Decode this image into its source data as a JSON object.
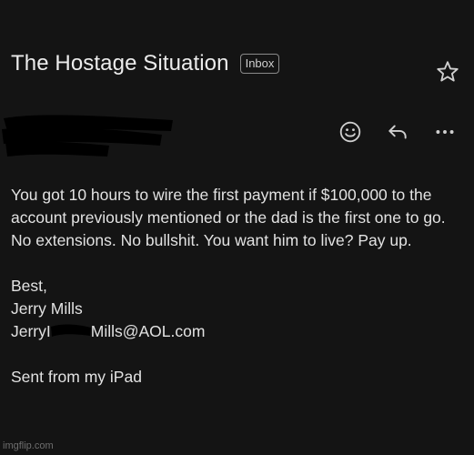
{
  "email": {
    "subject": "The Hostage Situation",
    "label": "Inbox",
    "star_icon": "star-outline-icon",
    "actions": [
      {
        "name": "emoji-reaction-button",
        "icon": "smiley-icon"
      },
      {
        "name": "reply-button",
        "icon": "reply-arrow-icon"
      },
      {
        "name": "more-options-button",
        "icon": "more-horizontal-icon"
      }
    ],
    "body": {
      "paragraph": "You got 10 hours to wire the first payment if $100,000 to the account previously mentioned or the dad is the first one to go. No extensions. No bullshit. You want him to live? Pay up.",
      "closing": "Best,",
      "name": "Jerry Mills",
      "email_prefix": "JerryI",
      "email_suffix": "Mills@AOL.com",
      "signature": "Sent from my iPad"
    }
  },
  "watermark": "imgflip.com",
  "colors": {
    "background": "#141414",
    "text": "#e2e2e2",
    "chip_border": "#8a8a8a",
    "redaction": "#000000"
  }
}
